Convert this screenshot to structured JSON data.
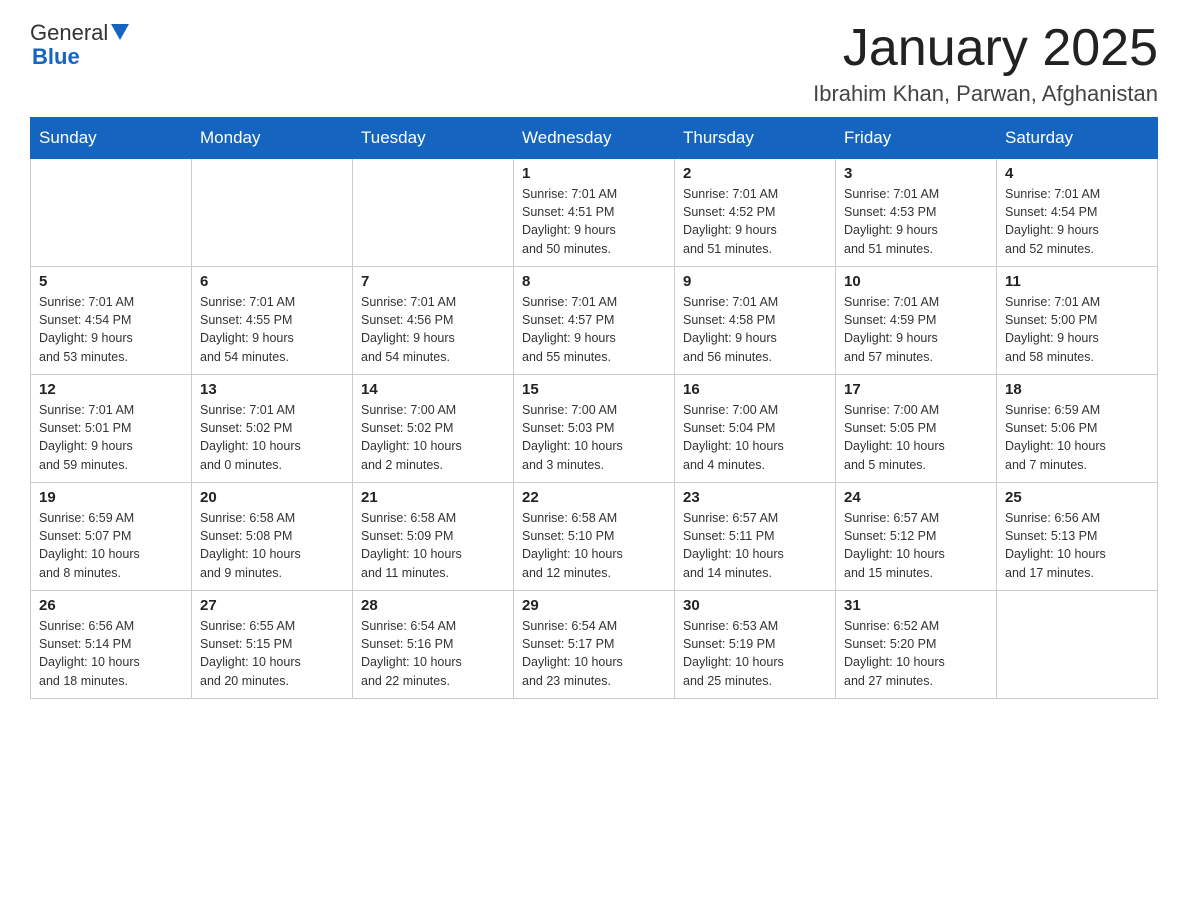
{
  "header": {
    "logo_general": "General",
    "logo_blue": "Blue",
    "month_title": "January 2025",
    "location": "Ibrahim Khan, Parwan, Afghanistan"
  },
  "calendar": {
    "days_of_week": [
      "Sunday",
      "Monday",
      "Tuesday",
      "Wednesday",
      "Thursday",
      "Friday",
      "Saturday"
    ],
    "weeks": [
      [
        {
          "day": "",
          "info": ""
        },
        {
          "day": "",
          "info": ""
        },
        {
          "day": "",
          "info": ""
        },
        {
          "day": "1",
          "info": "Sunrise: 7:01 AM\nSunset: 4:51 PM\nDaylight: 9 hours\nand 50 minutes."
        },
        {
          "day": "2",
          "info": "Sunrise: 7:01 AM\nSunset: 4:52 PM\nDaylight: 9 hours\nand 51 minutes."
        },
        {
          "day": "3",
          "info": "Sunrise: 7:01 AM\nSunset: 4:53 PM\nDaylight: 9 hours\nand 51 minutes."
        },
        {
          "day": "4",
          "info": "Sunrise: 7:01 AM\nSunset: 4:54 PM\nDaylight: 9 hours\nand 52 minutes."
        }
      ],
      [
        {
          "day": "5",
          "info": "Sunrise: 7:01 AM\nSunset: 4:54 PM\nDaylight: 9 hours\nand 53 minutes."
        },
        {
          "day": "6",
          "info": "Sunrise: 7:01 AM\nSunset: 4:55 PM\nDaylight: 9 hours\nand 54 minutes."
        },
        {
          "day": "7",
          "info": "Sunrise: 7:01 AM\nSunset: 4:56 PM\nDaylight: 9 hours\nand 54 minutes."
        },
        {
          "day": "8",
          "info": "Sunrise: 7:01 AM\nSunset: 4:57 PM\nDaylight: 9 hours\nand 55 minutes."
        },
        {
          "day": "9",
          "info": "Sunrise: 7:01 AM\nSunset: 4:58 PM\nDaylight: 9 hours\nand 56 minutes."
        },
        {
          "day": "10",
          "info": "Sunrise: 7:01 AM\nSunset: 4:59 PM\nDaylight: 9 hours\nand 57 minutes."
        },
        {
          "day": "11",
          "info": "Sunrise: 7:01 AM\nSunset: 5:00 PM\nDaylight: 9 hours\nand 58 minutes."
        }
      ],
      [
        {
          "day": "12",
          "info": "Sunrise: 7:01 AM\nSunset: 5:01 PM\nDaylight: 9 hours\nand 59 minutes."
        },
        {
          "day": "13",
          "info": "Sunrise: 7:01 AM\nSunset: 5:02 PM\nDaylight: 10 hours\nand 0 minutes."
        },
        {
          "day": "14",
          "info": "Sunrise: 7:00 AM\nSunset: 5:02 PM\nDaylight: 10 hours\nand 2 minutes."
        },
        {
          "day": "15",
          "info": "Sunrise: 7:00 AM\nSunset: 5:03 PM\nDaylight: 10 hours\nand 3 minutes."
        },
        {
          "day": "16",
          "info": "Sunrise: 7:00 AM\nSunset: 5:04 PM\nDaylight: 10 hours\nand 4 minutes."
        },
        {
          "day": "17",
          "info": "Sunrise: 7:00 AM\nSunset: 5:05 PM\nDaylight: 10 hours\nand 5 minutes."
        },
        {
          "day": "18",
          "info": "Sunrise: 6:59 AM\nSunset: 5:06 PM\nDaylight: 10 hours\nand 7 minutes."
        }
      ],
      [
        {
          "day": "19",
          "info": "Sunrise: 6:59 AM\nSunset: 5:07 PM\nDaylight: 10 hours\nand 8 minutes."
        },
        {
          "day": "20",
          "info": "Sunrise: 6:58 AM\nSunset: 5:08 PM\nDaylight: 10 hours\nand 9 minutes."
        },
        {
          "day": "21",
          "info": "Sunrise: 6:58 AM\nSunset: 5:09 PM\nDaylight: 10 hours\nand 11 minutes."
        },
        {
          "day": "22",
          "info": "Sunrise: 6:58 AM\nSunset: 5:10 PM\nDaylight: 10 hours\nand 12 minutes."
        },
        {
          "day": "23",
          "info": "Sunrise: 6:57 AM\nSunset: 5:11 PM\nDaylight: 10 hours\nand 14 minutes."
        },
        {
          "day": "24",
          "info": "Sunrise: 6:57 AM\nSunset: 5:12 PM\nDaylight: 10 hours\nand 15 minutes."
        },
        {
          "day": "25",
          "info": "Sunrise: 6:56 AM\nSunset: 5:13 PM\nDaylight: 10 hours\nand 17 minutes."
        }
      ],
      [
        {
          "day": "26",
          "info": "Sunrise: 6:56 AM\nSunset: 5:14 PM\nDaylight: 10 hours\nand 18 minutes."
        },
        {
          "day": "27",
          "info": "Sunrise: 6:55 AM\nSunset: 5:15 PM\nDaylight: 10 hours\nand 20 minutes."
        },
        {
          "day": "28",
          "info": "Sunrise: 6:54 AM\nSunset: 5:16 PM\nDaylight: 10 hours\nand 22 minutes."
        },
        {
          "day": "29",
          "info": "Sunrise: 6:54 AM\nSunset: 5:17 PM\nDaylight: 10 hours\nand 23 minutes."
        },
        {
          "day": "30",
          "info": "Sunrise: 6:53 AM\nSunset: 5:19 PM\nDaylight: 10 hours\nand 25 minutes."
        },
        {
          "day": "31",
          "info": "Sunrise: 6:52 AM\nSunset: 5:20 PM\nDaylight: 10 hours\nand 27 minutes."
        },
        {
          "day": "",
          "info": ""
        }
      ]
    ]
  }
}
